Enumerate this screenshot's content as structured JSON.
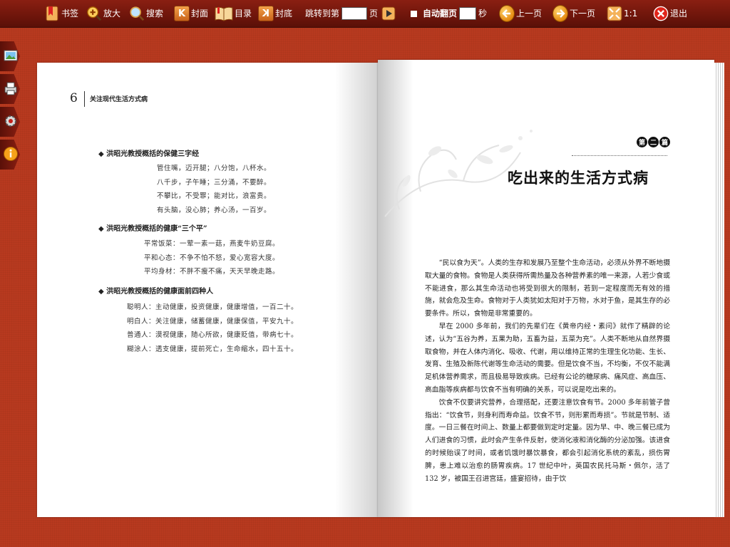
{
  "toolbar": {
    "bookmark": "书签",
    "zoom": "放大",
    "search": "搜索",
    "cover": "封面",
    "contents": "目录",
    "back_cover": "封底",
    "jump_prefix": "跳转到第",
    "jump_suffix": "页",
    "auto_flip": "自动翻页",
    "seconds": "秒",
    "prev_page": "上一页",
    "next_page": "下一页",
    "ratio": "1:1",
    "exit": "退出",
    "cover_glyph": "K",
    "back_cover_glyph": "K"
  },
  "left_page": {
    "page_number": "6",
    "running_head": "关注现代生活方式病",
    "sections": [
      {
        "title": "◆ 洪昭光教授概括的保健三字经",
        "lines": [
          "管住嘴，迈开腿；八分饱，八杯水。",
          "八千步，子午睡；三分涌，不要醉。",
          "不攀比，不受罪；能对比，浪富贵。",
          "有头脑，没心肺；养心汤，一百岁。"
        ]
      },
      {
        "title": "◆ 洪昭光教授概括的健康“三个平”",
        "lines": [
          "平常饭菜：一荤一素一菇，燕麦牛奶豆腐。",
          "平和心态：不争不怕不怒，爱心宽容大度。",
          "平均身材：不胖不瘦不痛，天天早晚走路。"
        ]
      },
      {
        "title": "◆ 洪昭光教授概括的健康面前四种人",
        "lines": [
          "聪明人：主动健康，投资健康，健康增值，一百二十。",
          "明白人：关注健康，储蓄健康，健康保值，平安九十。",
          "普通人：漠视健康，随心所欲，健康贬值，带病七十。",
          "糊涂人：透支健康，提前死亡，生命缩水，四十五十。"
        ]
      }
    ]
  },
  "right_page": {
    "badge": [
      "第",
      "二",
      "篇"
    ],
    "chapter_title": "吃出来的生活方式病",
    "paragraphs": [
      "“民以食为天”。人类的生存和发展乃至整个生命活动，必须从外界不断地摄取大量的食物。食物是人类获得所需热量及各种营养素的唯一来源，人若少食或不能进食，那么其生命活动也将受到很大的限制，若到一定程度而无有效的措施，就会危及生命。食物对于人类犹如太阳对于万物，水对于鱼，是其生存的必要条件。所以，食物是非常重要的。",
      "早在 2000 多年前，我们的先辈们在《黄帝内经・素问》就作了精辟的论述，认为“五谷为养，五果为助，五畜为益，五菜为充”。人类不断地从自然界摄取食物，并在人体内消化、吸收、代谢，用以维持正常的生理生化功能、生长、发育、生殖及新陈代谢等生命活动的需要。但是饮食不当，不均衡，不仅不能满足机体营养需求，而且极易导致疾病。已经有公论的糖尿病、痛风症、高血压、高血脂等疾病都与饮食不当有明确的关系，可以说是吃出来的。",
      "饮食不仅要讲究营养，合理搭配，还要注意饮食有节。2000 多年前管子曾指出：“饮食节，则身利而寿命益。饮食不节，则形累而寿损”。节就是节制、适度。一日三餐在时间上、数量上都要做到定时定量。因为早、中、晚三餐已成为人们进食的习惯，此时会产生条件反射，使消化液和消化酶的分泌加强。该进食的时候贻误了时间，或者饥饿时暴饮暴食，都会引起消化系统的紊乱，损伤胃脾，患上难以治愈的肠胃疾病。17 世纪中叶，英国农民托马斯・佩尔，活了 132 岁，被国王召进宫廷，盛宴招待，由于饮"
    ]
  }
}
